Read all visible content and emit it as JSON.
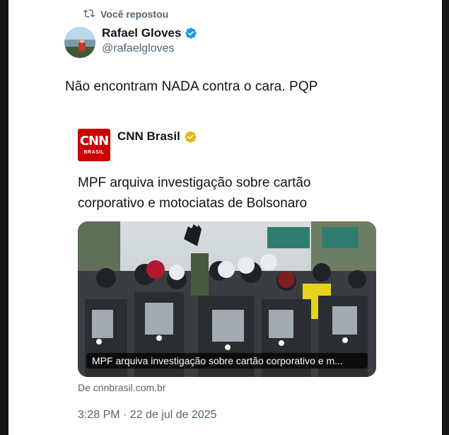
{
  "repost": {
    "label": "Você repostou"
  },
  "author": {
    "name": "Rafael Gloves",
    "handle": "@rafaelgloves"
  },
  "tweet": {
    "text": "Não encontram NADA contra o cara. PQP"
  },
  "quote": {
    "logo_text": "CNN",
    "logo_subtext": "BRASIL",
    "name": "CNN Brasil",
    "headline": "MPF arquiva investigação sobre cartão corporativo e motociatas de Bolsonaro",
    "media_caption": "MPF arquiva investigação sobre cartão corporativo e m...",
    "source": "De cnnbrasil.com.br"
  },
  "timestamp": "3:28 PM · 22 de jul de 2025",
  "colors": {
    "verified_blue": "#1d9bf0",
    "verified_gold": "#e2b719",
    "cnn_red": "#cc0000",
    "muted_text": "#536471"
  }
}
